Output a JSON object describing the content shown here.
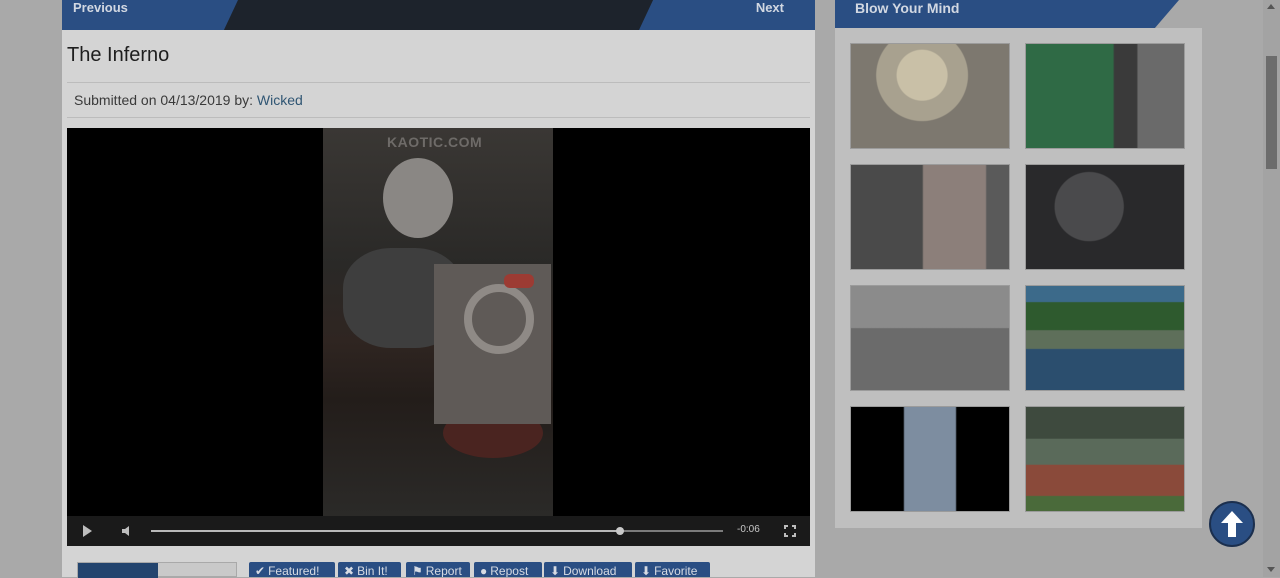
{
  "nav": {
    "previous_label": "Previous",
    "next_label": "Next"
  },
  "post": {
    "title": "The Inferno",
    "submitted_prefix": "Submitted on 04/13/2019 by: ",
    "author": "Wicked"
  },
  "video": {
    "watermark": "KAOTIC.COM",
    "time_remaining": "-0:06",
    "progress_fraction": 0.82
  },
  "actions": [
    {
      "icon": "check-icon",
      "label": "Featured!"
    },
    {
      "icon": "trash-icon",
      "label": "Bin It!"
    },
    {
      "icon": "flag-icon",
      "label": "Report"
    },
    {
      "icon": "repost-icon",
      "label": "Repost"
    },
    {
      "icon": "download-icon",
      "label": "Download"
    },
    {
      "icon": "favorite-icon",
      "label": "Favorite"
    }
  ],
  "sidebar": {
    "title": "Blow Your Mind",
    "thumbnail_count": 8
  },
  "colors": {
    "accent": "#2a4e83",
    "nav_dark": "#1d232c",
    "link": "#2f5573"
  },
  "icons": {
    "back_to_top": "arrow-up-icon",
    "play": "play-icon",
    "volume": "volume-icon",
    "fullscreen": "fullscreen-icon"
  }
}
